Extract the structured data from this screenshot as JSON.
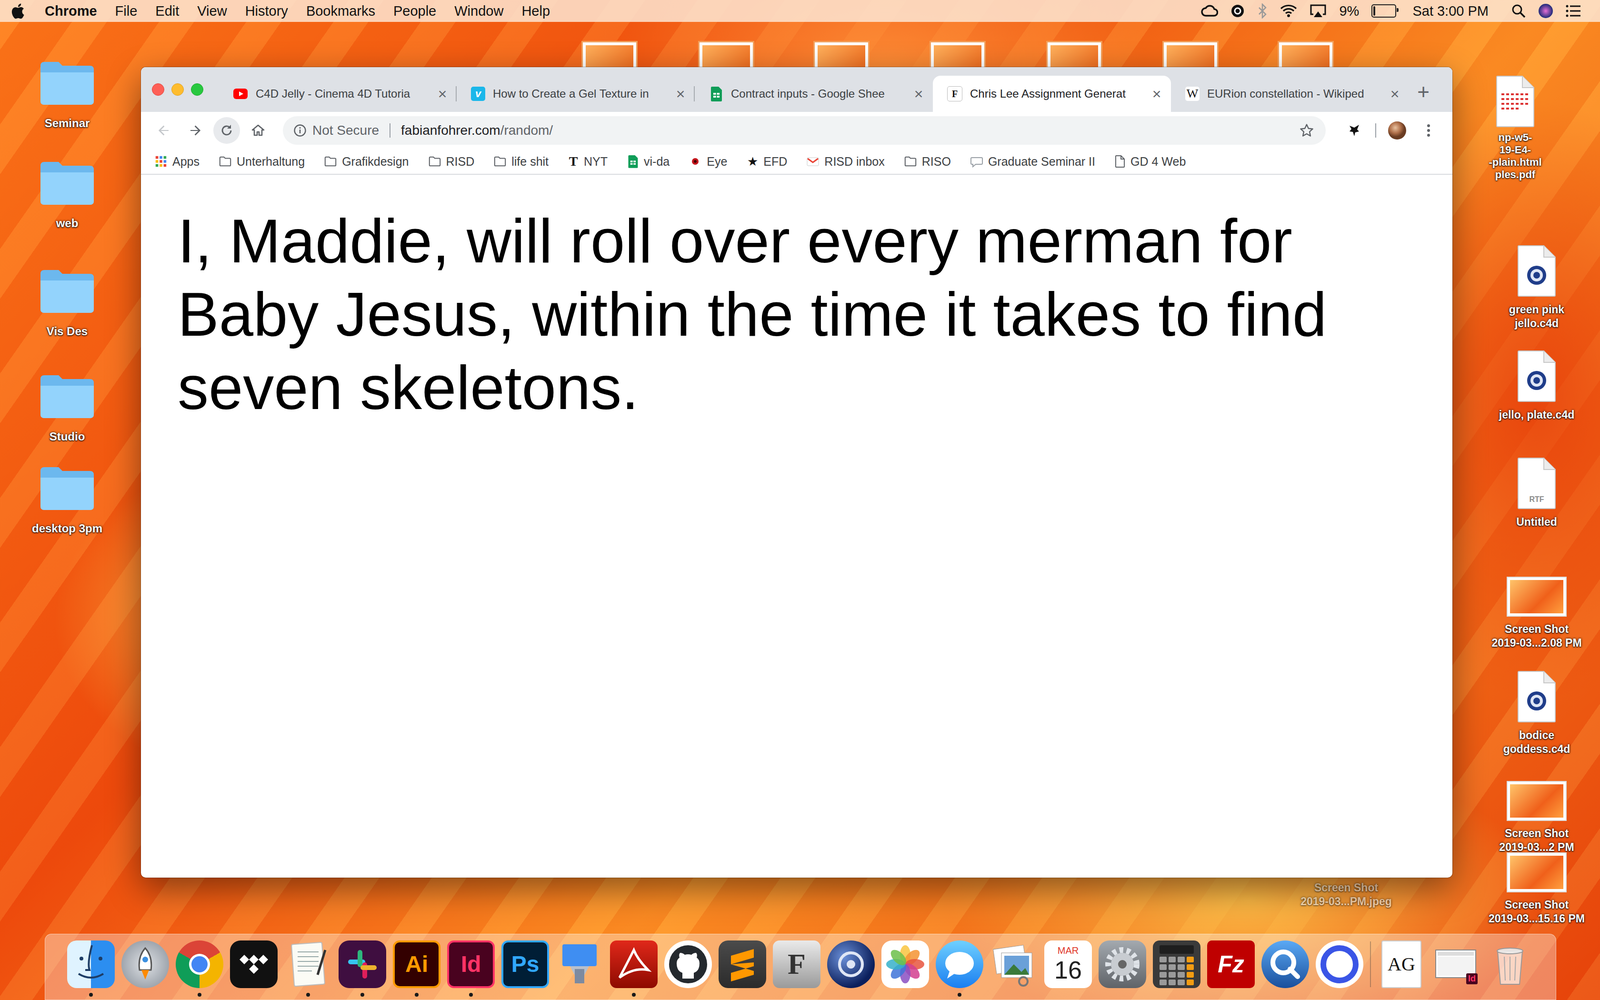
{
  "menu_bar": {
    "app": "Chrome",
    "items": [
      "File",
      "Edit",
      "View",
      "History",
      "Bookmarks",
      "People",
      "Window",
      "Help"
    ],
    "battery": {
      "reading": "9%",
      "level": 0.09
    },
    "clock": "Sat 3:00 PM"
  },
  "desktop": {
    "folders": [
      {
        "label": "Seminar"
      },
      {
        "label": "web"
      },
      {
        "label": "Vis Des"
      },
      {
        "label": "Studio"
      },
      {
        "label": "desktop 3pm"
      }
    ],
    "files": [
      {
        "kind": "c4d",
        "lines": [
          "green pink",
          "jello.c4d"
        ]
      },
      {
        "kind": "c4d",
        "lines": [
          "jello, plate.c4d"
        ]
      },
      {
        "kind": "rtf",
        "badge": "RTF",
        "lines": [
          "Untitled"
        ]
      },
      {
        "kind": "screenshot",
        "lines": [
          "Screen Shot",
          "2019-03...2.08 PM"
        ]
      },
      {
        "kind": "c4d",
        "lines": [
          "bodice",
          "goddess.c4d"
        ]
      },
      {
        "kind": "screenshot",
        "lines": [
          "Screen Shot",
          "2019-03...2 PM"
        ]
      },
      {
        "kind": "screenshot",
        "lines": [
          "Screen Shot",
          "2019-03...15.16 PM"
        ]
      }
    ],
    "partial_file": {
      "kind": "pdf",
      "lines": [
        "np-w5-",
        "19-E4-",
        "-plain.html",
        "ples.pdf"
      ]
    },
    "dragged_file": {
      "lines": [
        "Screen Shot",
        "2019-03...PM.jpeg"
      ]
    }
  },
  "browser": {
    "tabs": [
      {
        "title": "C4D Jelly - Cinema 4D Tutoria",
        "icon": "youtube",
        "selected": false
      },
      {
        "title": "How to Create a Gel Texture in",
        "icon": "vimeo",
        "icon_text": "v",
        "selected": false
      },
      {
        "title": "Contract inputs - Google Shee",
        "icon": "sheets",
        "selected": false
      },
      {
        "title": "Chris Lee Assignment Generat",
        "icon": "site",
        "icon_text": "F",
        "selected": true
      },
      {
        "title": "EURion constellation - Wikiped",
        "icon": "wikipedia",
        "icon_text": "W",
        "selected": false
      }
    ],
    "close_glyph": "×",
    "new_tab": "+",
    "navigation": {
      "back_disabled": true
    },
    "security": "Not Secure",
    "url_host": "fabianfohrer.com",
    "url_path": "/random/",
    "bookmarks": [
      {
        "label": "Apps",
        "kind": "apps"
      },
      {
        "label": "Unterhaltung",
        "kind": "folder"
      },
      {
        "label": "Grafikdesign",
        "kind": "folder"
      },
      {
        "label": "RISD",
        "kind": "folder"
      },
      {
        "label": "life shit",
        "kind": "folder"
      },
      {
        "label": "NYT",
        "kind": "nyt",
        "icon": "T"
      },
      {
        "label": "vi-da",
        "kind": "sheets"
      },
      {
        "label": "Eye",
        "kind": "dot"
      },
      {
        "label": "EFD",
        "kind": "star",
        "icon": "★"
      },
      {
        "label": "RISD inbox",
        "kind": "gmail"
      },
      {
        "label": "RISO",
        "kind": "folder"
      },
      {
        "label": "Graduate Seminar II",
        "kind": "bubble"
      },
      {
        "label": "GD 4 Web",
        "kind": "doc"
      }
    ],
    "content": "I, Maddie, will roll over every merman for Baby Jesus, within the time it takes to find seven skeletons."
  },
  "dock": {
    "apps": [
      {
        "app": "finder",
        "running": true
      },
      {
        "app": "launchpad",
        "running": false
      },
      {
        "app": "chrome",
        "running": true
      },
      {
        "app": "tidal",
        "running": false
      },
      {
        "app": "textedit",
        "running": true
      },
      {
        "app": "slack",
        "running": true
      },
      {
        "app": "illustrator",
        "text": "Ai",
        "running": true
      },
      {
        "app": "indesign",
        "text": "Id",
        "running": true
      },
      {
        "app": "photoshop",
        "text": "Ps",
        "running": false
      },
      {
        "app": "keynote",
        "running": false
      },
      {
        "app": "acrobat",
        "running": true
      },
      {
        "app": "github",
        "running": false
      },
      {
        "app": "sublime",
        "running": false
      },
      {
        "app": "fontlab",
        "text": "F",
        "running": false
      },
      {
        "app": "cinema4d",
        "running": false
      },
      {
        "app": "photos",
        "running": false
      },
      {
        "app": "messages",
        "running": true
      },
      {
        "app": "preview",
        "running": false
      },
      {
        "app": "calendar",
        "month": "MAR",
        "text": "16",
        "running": false
      },
      {
        "app": "system-preferences",
        "running": false
      },
      {
        "app": "calculator",
        "running": false
      },
      {
        "app": "filezilla",
        "text": "Fz",
        "running": false
      },
      {
        "app": "quicktime",
        "running": false
      },
      {
        "app": "ring",
        "running": false
      }
    ],
    "documents": [
      {
        "app": "fontbook",
        "text": "AG",
        "running": false
      },
      {
        "app": "screenshot-stack",
        "text": "Id",
        "running": false
      },
      {
        "app": "trash",
        "running": false
      }
    ]
  }
}
